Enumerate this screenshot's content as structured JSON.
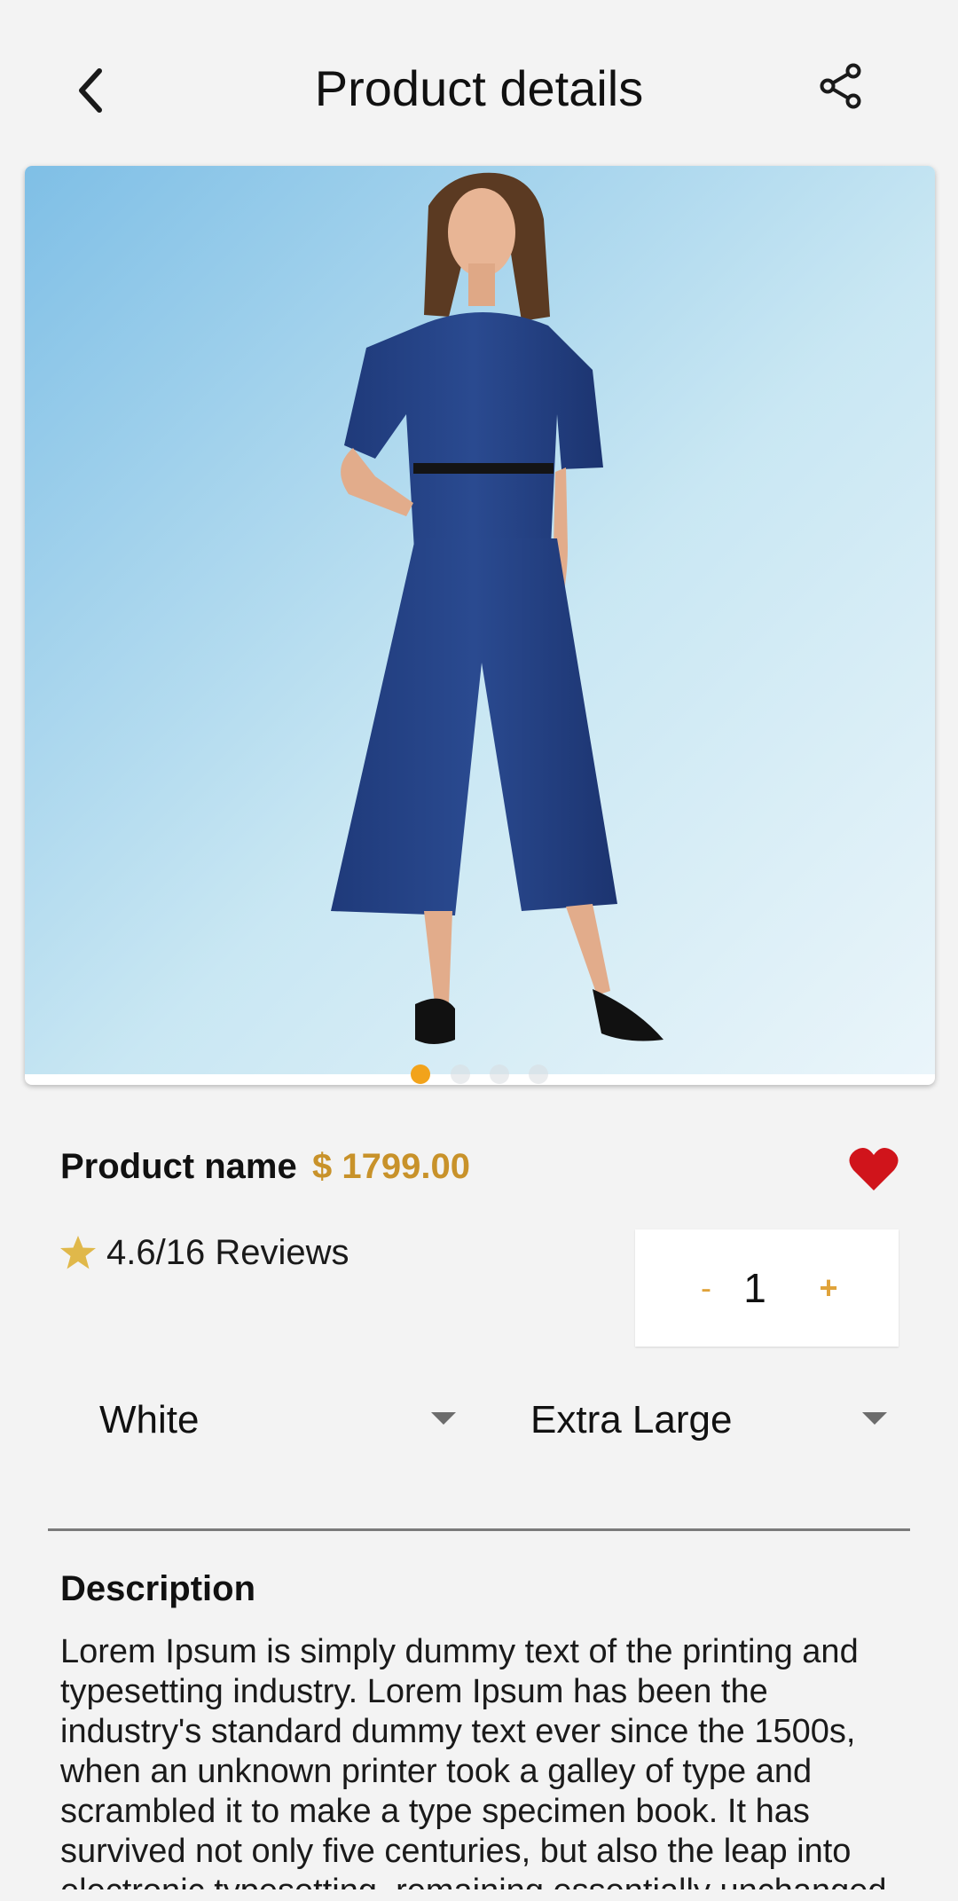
{
  "header": {
    "title": "Product details",
    "back_icon": "chevron-left-icon",
    "share_icon": "share-icon"
  },
  "gallery": {
    "image_description": "model wearing navy blue short-sleeve top with belt and wide cropped trousers, light blue backdrop",
    "slide_count": 4,
    "active_slide": 1,
    "active_dot_color": "#f2a31b"
  },
  "product": {
    "name": "Product name",
    "price": "$ 1799.00",
    "price_color": "#c8922a",
    "favorite": true,
    "favorite_color": "#d0141b"
  },
  "rating": {
    "text": "4.6/16 Reviews",
    "star_color": "#e0b84a"
  },
  "quantity": {
    "minus_label": "-",
    "value": "1",
    "plus_label": "+"
  },
  "options": {
    "color": {
      "selected": "White"
    },
    "size": {
      "selected": "Extra Large"
    }
  },
  "description": {
    "title": "Description",
    "text": "Lorem Ipsum is simply dummy text of the printing and typesetting industry. Lorem Ipsum has been the industry's standard dummy text ever since the 1500s, when an unknown printer took a galley of type and scrambled it to make a type specimen book. It has survived not only five centuries, but also the leap into electronic typesetting, remaining essentially unchanged."
  }
}
